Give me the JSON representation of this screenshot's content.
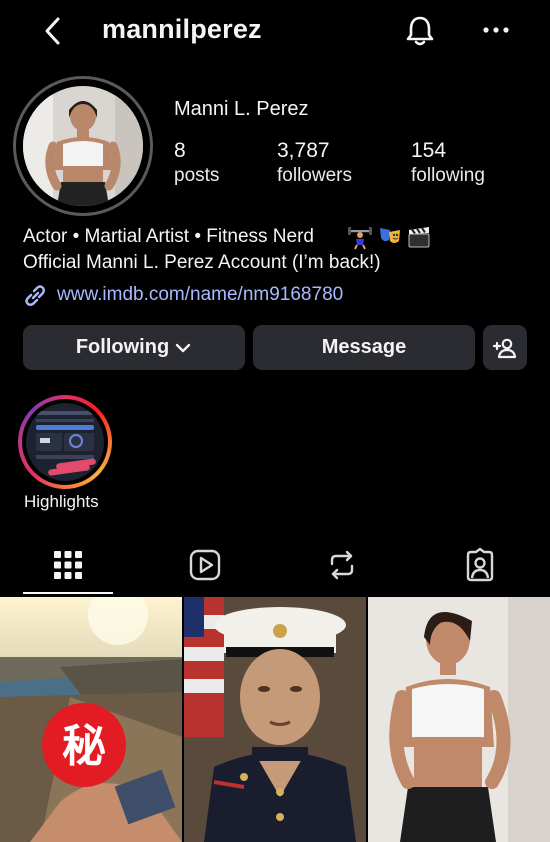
{
  "header": {
    "username": "mannilperez"
  },
  "profile": {
    "display_name": "Manni L. Perez",
    "stats": [
      {
        "value": "8",
        "label": "posts"
      },
      {
        "value": "3,787",
        "label": "followers"
      },
      {
        "value": "154",
        "label": "following"
      }
    ],
    "bio_line1": "Actor • Martial Artist • Fitness Nerd",
    "bio_line2": "Official Manni L. Perez Account (I’m back!)",
    "link": "www.imdb.com/name/nm9168780"
  },
  "actions": {
    "following_label": "Following",
    "message_label": "Message"
  },
  "highlights": [
    {
      "label": "Highlights"
    }
  ],
  "tabs": [
    {
      "icon": "grid-icon",
      "active": true
    },
    {
      "icon": "reels-icon",
      "active": false
    },
    {
      "icon": "reposts-icon",
      "active": false
    },
    {
      "icon": "tagged-icon",
      "active": false
    }
  ],
  "posts_count_shown": 3,
  "colors": {
    "background": "#000000",
    "button": "#2a2c31",
    "link": "#a9b9ff"
  }
}
